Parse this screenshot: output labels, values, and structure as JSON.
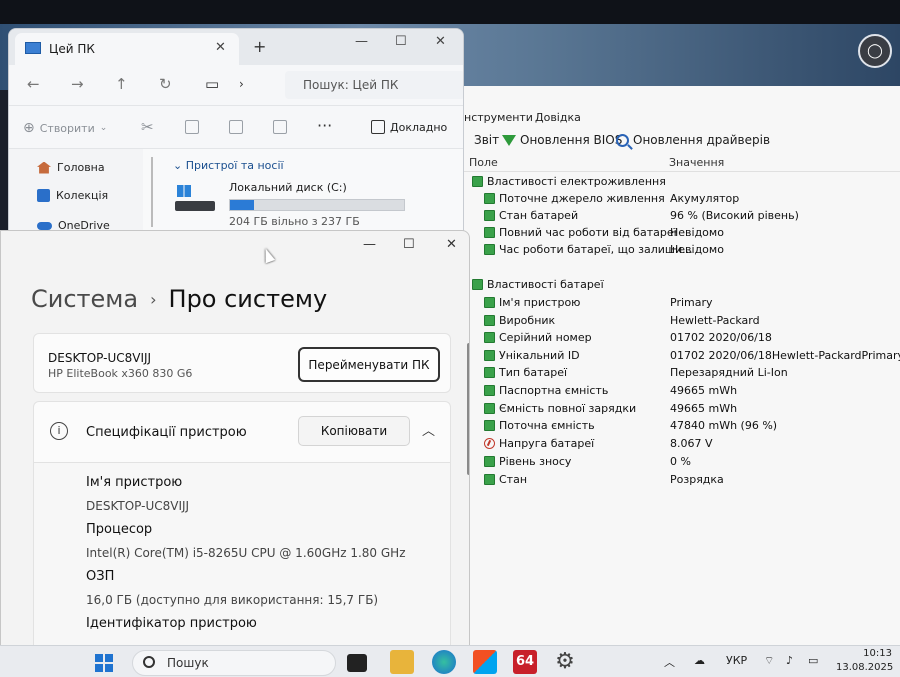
{
  "aida": {
    "menu": {
      "tools": "нструменти",
      "help": "Довідка"
    },
    "toolbar": {
      "report": "Звіт",
      "bios_update": "Оновлення BIOS",
      "driver_update": "Оновлення драйверів"
    },
    "columns": {
      "field": "Поле",
      "value": "Значення"
    },
    "power_section": "Властивості електроживлення",
    "power_rows": [
      {
        "name": "Поточне джерело живлення",
        "value": "Акумулятор"
      },
      {
        "name": "Стан батарей",
        "value": "96 % (Високий рівень)"
      },
      {
        "name": "Повний час роботи від батареї",
        "value": "Невідомо"
      },
      {
        "name": "Час роботи батареї, що залиши...",
        "value": "Невідомо"
      }
    ],
    "battery_section": "Властивості батареї",
    "battery_rows": [
      {
        "name": "Ім'я пристрою",
        "value": "Primary"
      },
      {
        "name": "Виробник",
        "value": "Hewlett-Packard"
      },
      {
        "name": "Серійний номер",
        "value": "01702 2020/06/18"
      },
      {
        "name": "Унікальний ID",
        "value": "01702 2020/06/18Hewlett-PackardPrimary"
      },
      {
        "name": "Тип батареї",
        "value": "Перезарядний Li-Ion"
      },
      {
        "name": "Паспортна ємність",
        "value": "49665 mWh"
      },
      {
        "name": "Ємність повної зарядки",
        "value": "49665 mWh"
      },
      {
        "name": "Поточна ємність",
        "value": "47840 mWh  (96 %)"
      },
      {
        "name": "Напруга батареї",
        "value": "8.067 V"
      },
      {
        "name": "Рівень зносу",
        "value": "0 %"
      },
      {
        "name": "Стан",
        "value": "Розрядка"
      }
    ]
  },
  "explorer": {
    "tab_title": "Цей ПК",
    "search_placeholder": "Пошук: Цей ПК",
    "new_label": "Створити",
    "details_label": "Докладно",
    "sidebar": [
      "Головна",
      "Колекція",
      "OneDrive"
    ],
    "section_title": "Пристрої та носії",
    "drive_name": "Локальний диск (C:)",
    "drive_free": "204 ГБ вільно з 237 ГБ",
    "drive_used_fraction": 0.14
  },
  "settings": {
    "crumb_parent": "Система",
    "crumb_current": "Про систему",
    "device_name": "DESKTOP-UC8VIJJ",
    "device_model": "HP EliteBook x360 830 G6",
    "rename_button": "Перейменувати ПК",
    "specs_title": "Специфікації пристрою",
    "copy_button": "Копіювати",
    "specs": [
      {
        "key": "Ім'я пристрою",
        "value": "DESKTOP-UC8VIJJ"
      },
      {
        "key": "Процесор",
        "value": "Intel(R) Core(TM) i5-8265U CPU @ 1.60GHz   1.80 GHz"
      },
      {
        "key": "ОЗП",
        "value": "16,0 ГБ (доступно для використання: 15,7 ГБ)"
      },
      {
        "key": "Ідентифікатор пристрою",
        "value": ""
      }
    ]
  },
  "taskbar": {
    "search_label": "Пошук",
    "aida_badge": "64",
    "language": "УКР",
    "time": "10:13",
    "date": "13.08.2025"
  },
  "colors": {
    "accent": "#1f73d0",
    "aida_green": "#3aa14a"
  }
}
